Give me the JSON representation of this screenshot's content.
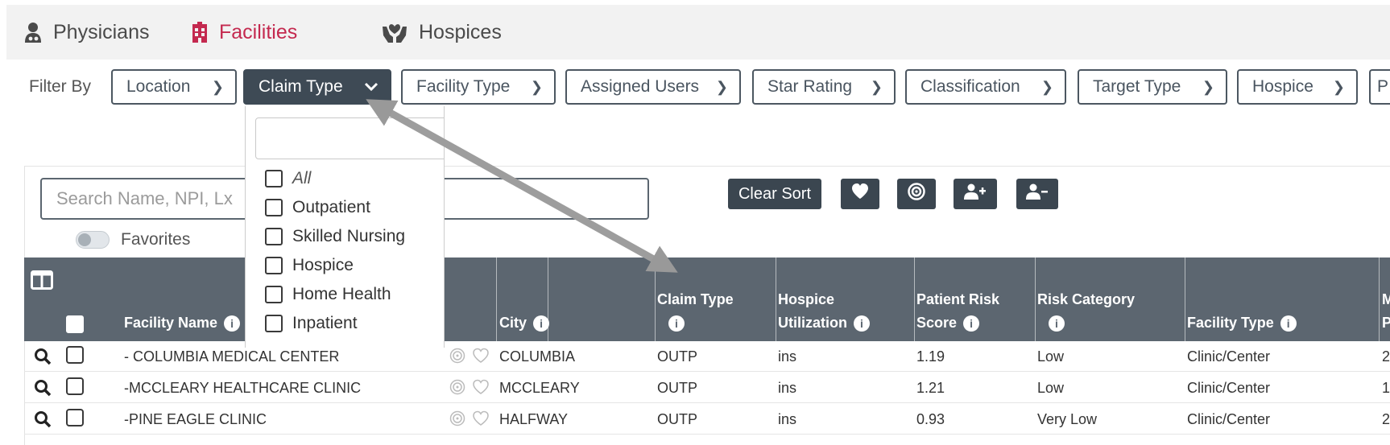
{
  "nav": {
    "tabs": [
      {
        "label": "Physicians",
        "active": false,
        "icon": "doctor-icon"
      },
      {
        "label": "Facilities",
        "active": true,
        "icon": "building-icon"
      },
      {
        "label": "Hospices",
        "active": false,
        "icon": "hands-heart-icon"
      }
    ]
  },
  "filter": {
    "label": "Filter By",
    "buttons": [
      {
        "label": "Location"
      },
      {
        "label": "Claim Type",
        "active": true
      },
      {
        "label": "Facility Type"
      },
      {
        "label": "Assigned Users"
      },
      {
        "label": "Star Rating"
      },
      {
        "label": "Classification"
      },
      {
        "label": "Target Type"
      },
      {
        "label": "Hospice"
      },
      {
        "label": "P"
      }
    ]
  },
  "dropdown": {
    "search_value": "",
    "options": [
      {
        "label": "All",
        "checked": false
      },
      {
        "label": "Outpatient",
        "checked": false
      },
      {
        "label": "Skilled Nursing",
        "checked": false
      },
      {
        "label": "Hospice",
        "checked": false
      },
      {
        "label": "Home Health",
        "checked": false
      },
      {
        "label": "Inpatient",
        "checked": false
      }
    ]
  },
  "search": {
    "placeholder": "Search Name, NPI, Lx"
  },
  "favorites": {
    "label": "Favorites",
    "on": false
  },
  "toolbar": {
    "clear_sort": "Clear Sort"
  },
  "table": {
    "headers": {
      "facility_name": "Facility Name",
      "city": "City",
      "claim_type_l1": "Claim Type",
      "hospice_l1": "Hospice",
      "hospice_l2": "Utilization",
      "risk_l1": "Patient Risk",
      "risk_l2": "Score",
      "risk_cat": "Risk Category",
      "facility_type": "Facility Type",
      "m_l1": "M",
      "m_l2": "P"
    },
    "rows": [
      {
        "name": "- COLUMBIA MEDICAL CENTER",
        "city": "COLUMBIA",
        "claim": "OUTP",
        "hospice": "ins",
        "score": "1.19",
        "risk": "Low",
        "ftype": "Clinic/Center",
        "m": "2"
      },
      {
        "name": "-MCCLEARY HEALTHCARE CLINIC",
        "city": "MCCLEARY",
        "claim": "OUTP",
        "hospice": "ins",
        "score": "1.21",
        "risk": "Low",
        "ftype": "Clinic/Center",
        "m": "1"
      },
      {
        "name": "-PINE EAGLE CLINIC",
        "city": "HALFWAY",
        "claim": "OUTP",
        "hospice": "ins",
        "score": "0.93",
        "risk": "Very Low",
        "ftype": "Clinic/Center",
        "m": "2"
      }
    ]
  },
  "colors": {
    "active_tab": "#c4294f",
    "header_bg": "#5c6670",
    "button_dark": "#3b4650"
  }
}
